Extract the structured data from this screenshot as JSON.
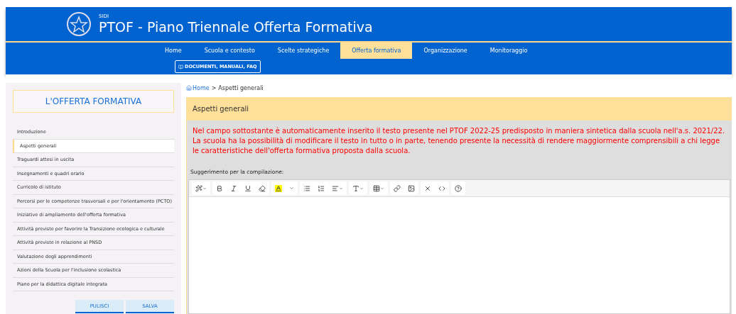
{
  "header": {
    "overline": "SIDI",
    "title": "PTOF - Piano Triennale Offerta Formativa"
  },
  "nav": [
    {
      "label": "Home",
      "selected": false
    },
    {
      "label": "Scuola e contesto",
      "selected": false
    },
    {
      "label": "Scelte strategiche",
      "selected": false
    },
    {
      "label": "Offerta formativa",
      "selected": true
    },
    {
      "label": "Organizzazione",
      "selected": false
    },
    {
      "label": "Monitoraggio",
      "selected": false
    }
  ],
  "docs_button": "DOCUMENTI, MANUALI, FAQ",
  "sidebar": {
    "title": "L'OFFERTA FORMATIVA",
    "items": [
      {
        "label": "Introduzione",
        "selected": false
      },
      {
        "label": "Aspetti generali",
        "selected": true
      },
      {
        "label": "Traguardi attesi in uscita",
        "selected": false
      },
      {
        "label": "Insegnamenti e quadri orario",
        "selected": false
      },
      {
        "label": "Curricolo di istituto",
        "selected": false
      },
      {
        "label": "Percorsi per le competenze trasversali e per l'orientamento (PCTO)",
        "selected": false
      },
      {
        "label": "Iniziative di ampliamento dell'offerta formativa",
        "selected": false
      },
      {
        "label": "Attività previste per favorire la Transizione ecologica e culturale",
        "selected": false
      },
      {
        "label": "Attività previste in relazione al PNSD",
        "selected": false
      },
      {
        "label": "Valutazione degli apprendimenti",
        "selected": false
      },
      {
        "label": "Azioni della Scuola per l'inclusione scolastica",
        "selected": false
      },
      {
        "label": "Piano per la didattica digitale integrata",
        "selected": false
      }
    ],
    "buttons": [
      "PULISCI",
      "SALVA"
    ]
  },
  "breadcrumb": [
    "Home",
    ">",
    "Aspetti generali"
  ],
  "panel": {
    "title": "Aspetti generali",
    "notice": [
      "Nel campo sottostante è automaticamente inserito il testo presente nel PTOF 2022-25 predisposto in maniera sintetica dalla scuola nell'a.s. 2021/22.",
      "La scuola ha la possibilità di modificare il testo in tutto o in parte, tenendo presente la necessità di rendere maggiormente comprensibili a chi legge le caratteristiche dell'offerta formativa proposta dalla scuola."
    ],
    "hint": "Suggerimento per la compilazione:"
  }
}
